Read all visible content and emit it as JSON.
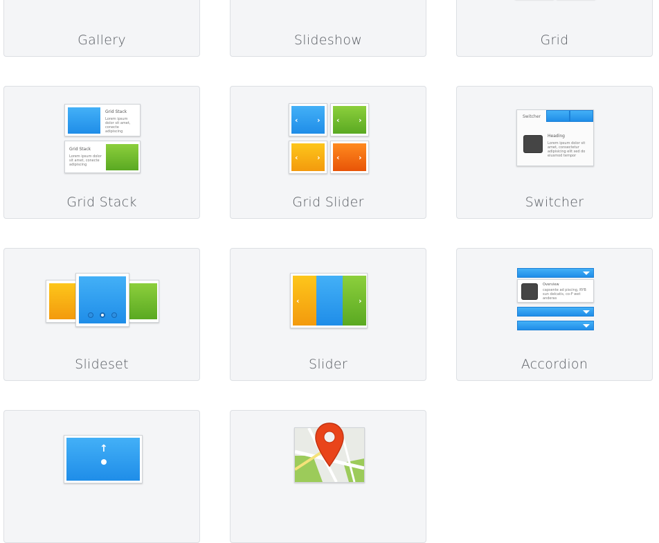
{
  "cards": [
    {
      "label": "Gallery"
    },
    {
      "label": "Slideshow"
    },
    {
      "label": "Grid"
    },
    {
      "label": "Grid Stack"
    },
    {
      "label": "Grid Slider"
    },
    {
      "label": "Switcher"
    },
    {
      "label": "Slideset"
    },
    {
      "label": "Slider"
    },
    {
      "label": "Accordion"
    },
    {
      "label": ""
    },
    {
      "label": ""
    }
  ],
  "thumbnails": {
    "grid_stack": {
      "heading": "Grid Stack",
      "text": "Lorem ipsum dolor sit amet, conecte adipiscing"
    },
    "switcher": {
      "title": "Switcher",
      "heading": "Heading",
      "text": "Lorem ipsum dolor sit amet, consectetur adipisicing elit sed do eiusmod tempor"
    },
    "accordion": {
      "heading": "Overview",
      "text": "capsente ad piscing, RYB sun delcatis, co-F wet anderas"
    }
  },
  "icons": {
    "arrow_left": "‹",
    "arrow_right": "›",
    "arrow_up": "↑"
  },
  "colors": {
    "blue": "#2e9cf0",
    "green": "#6dbb2b",
    "yellow": "#fbb515",
    "orange": "#f26a10",
    "map_pin": "#e9441a"
  }
}
